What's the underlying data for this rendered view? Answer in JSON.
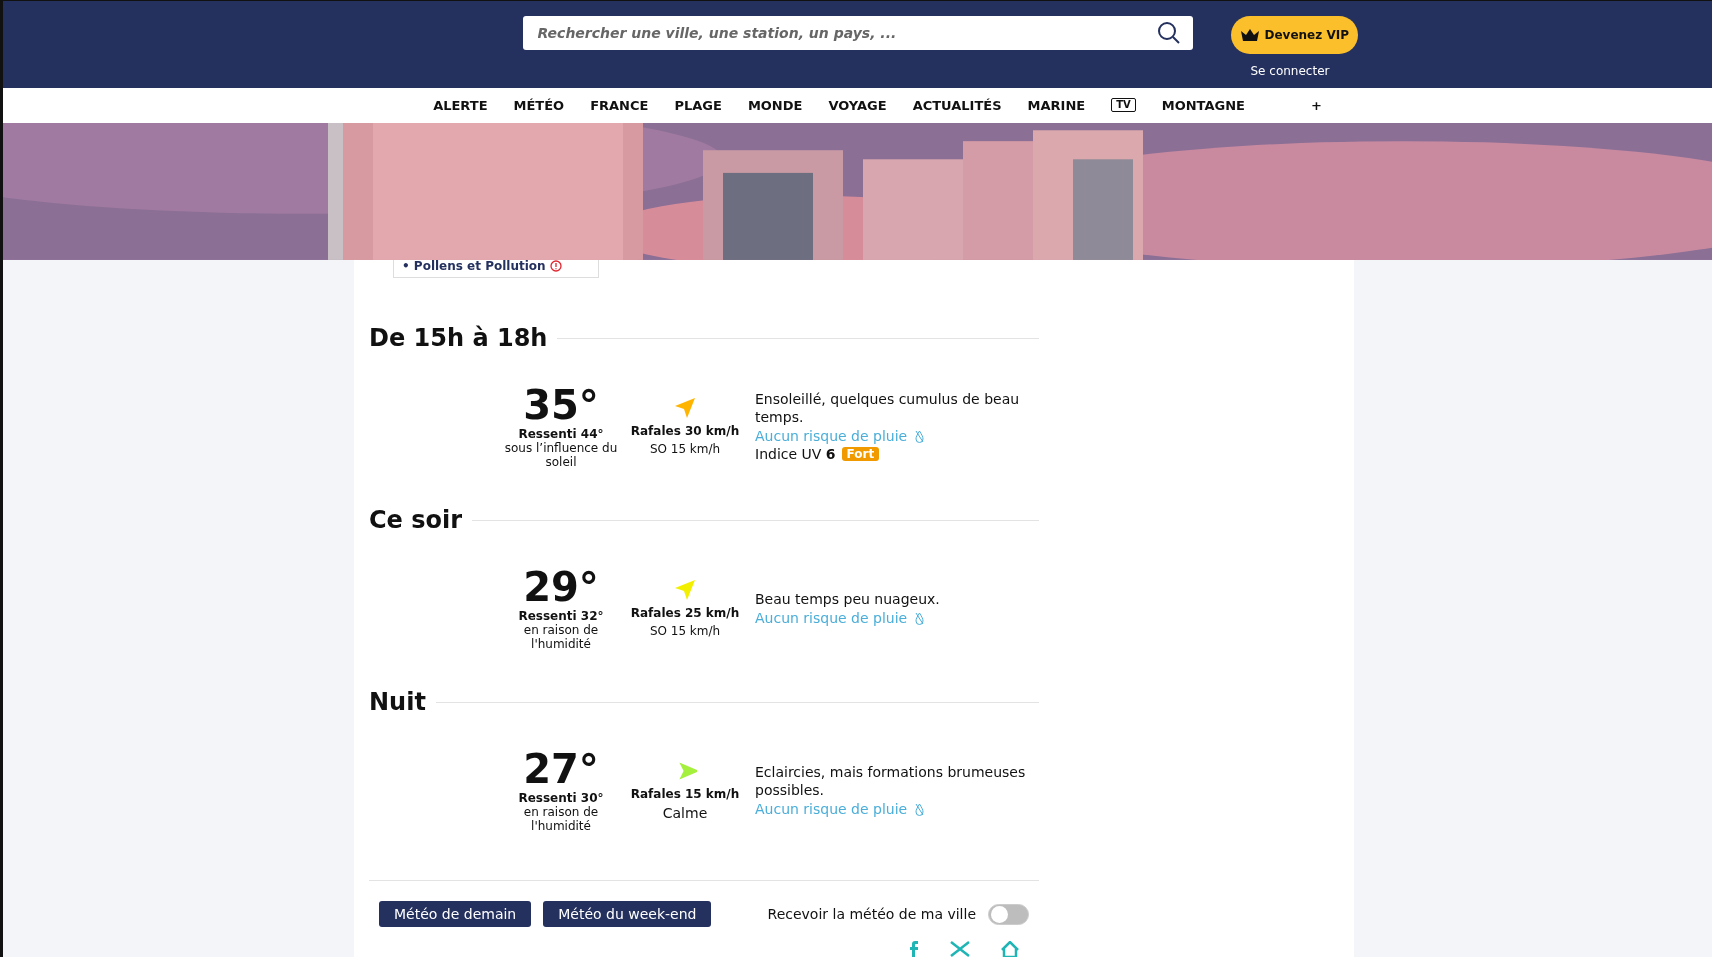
{
  "header": {
    "search": {
      "placeholder": "Rechercher une ville, une station, un pays, ..."
    },
    "vip_button": "Devenez VIP",
    "login_link": "Se connecter"
  },
  "nav": [
    {
      "kind": "text",
      "label": "ALERTE"
    },
    {
      "kind": "text",
      "label": "MÉTÉO"
    },
    {
      "kind": "text",
      "label": "FRANCE"
    },
    {
      "kind": "text",
      "label": "PLAGE"
    },
    {
      "kind": "text",
      "label": "MONDE"
    },
    {
      "kind": "text",
      "label": "VOYAGE"
    },
    {
      "kind": "text",
      "label": "ACTUALITÉS"
    },
    {
      "kind": "text",
      "label": "MARINE"
    },
    {
      "kind": "tv",
      "label": "TV"
    },
    {
      "kind": "text",
      "label": "MONTAGNE"
    },
    {
      "kind": "more",
      "label": "+"
    }
  ],
  "pollen_link": "• Pollens et Pollution",
  "periods": [
    {
      "title": "De 15h à 18h",
      "temperature": "35°",
      "feels_like": "Ressenti 44°",
      "feels_reason": "sous l’influence du soleil",
      "gusts": "Rafales 30 km/h",
      "wind": "SO 15 km/h",
      "wind_arrow": {
        "kind": "northeast",
        "color": "#ffb400"
      },
      "description": "Ensoleillé, quelques cumulus de beau temps.",
      "rain": "Aucun risque de pluie",
      "uv": {
        "label": "Indice UV",
        "value": "6",
        "badge": "Fort",
        "color": "#f09a00"
      }
    },
    {
      "title": "Ce soir",
      "temperature": "29°",
      "feels_like": "Ressenti 32°",
      "feels_reason": "en raison de l'humidité",
      "gusts": "Rafales 25 km/h",
      "wind": "SO 15 km/h",
      "wind_arrow": {
        "kind": "northeast",
        "color": "#f2f000"
      },
      "description": "Beau temps peu nuageux.",
      "rain": "Aucun risque de pluie"
    },
    {
      "title": "Nuit",
      "temperature": "27°",
      "feels_like": "Ressenti 30°",
      "feels_reason": "en raison de l'humidité",
      "gusts": "Rafales 15 km/h",
      "wind": "Calme",
      "wind_arrow": {
        "kind": "east",
        "color": "#a5f03c"
      },
      "description": "Eclaircies, mais formations brumeuses possibles.",
      "rain": "Aucun risque de pluie"
    }
  ],
  "footer": {
    "buttons": [
      "Météo de demain",
      "Météo du week-end"
    ],
    "subscribe": {
      "label": "Recevoir la météo de ma ville",
      "on": false
    }
  }
}
